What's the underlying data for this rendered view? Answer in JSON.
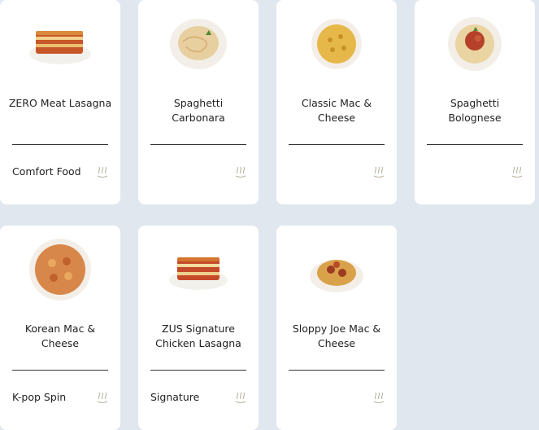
{
  "cards": [
    {
      "title": "ZERO Meat Lasagna",
      "tag": "Comfort Food",
      "image_icon": "lasagna-image"
    },
    {
      "title": "Spaghetti Carbonara",
      "tag": "",
      "image_icon": "carbonara-image"
    },
    {
      "title": "Classic Mac & Cheese",
      "tag": "",
      "image_icon": "mac-cheese-image"
    },
    {
      "title": "Spaghetti Bolognese",
      "tag": "",
      "image_icon": "bolognese-image"
    },
    {
      "title": "Korean Mac & Cheese",
      "tag": "K-pop Spin",
      "image_icon": "korean-mac-image"
    },
    {
      "title": "ZUS Signature Chicken Lasagna",
      "tag": "Signature",
      "image_icon": "chicken-lasagna-image"
    },
    {
      "title": "Sloppy Joe Mac & Cheese",
      "tag": "",
      "image_icon": "sloppy-joe-image"
    }
  ],
  "colors": {
    "background": "#e1e7ef",
    "card": "#ffffff",
    "text": "#222222"
  },
  "icon": "hot-steam-icon"
}
